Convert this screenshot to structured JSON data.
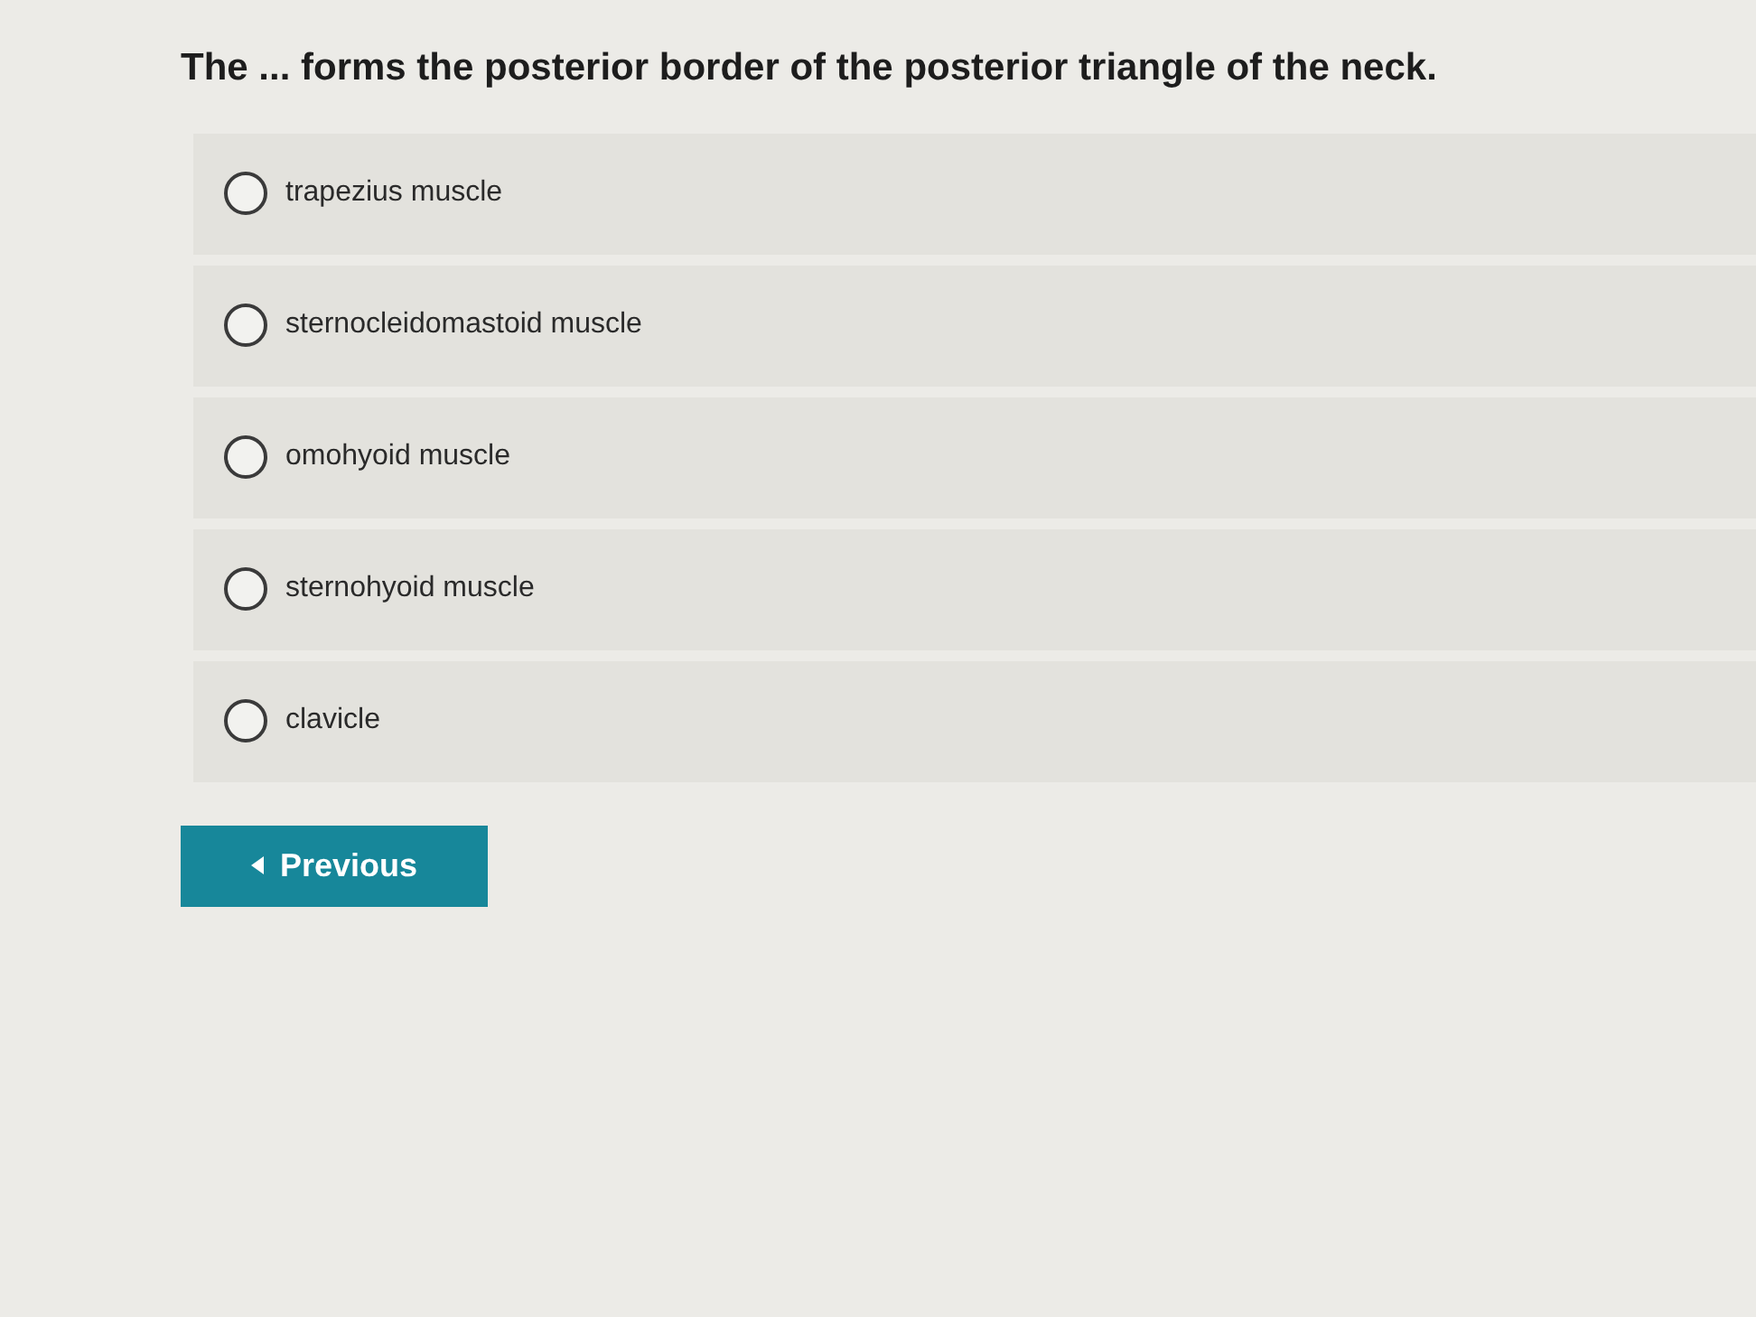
{
  "question": "The ... forms the posterior border of the posterior triangle of the neck.",
  "options": [
    {
      "label": "trapezius muscle",
      "selected": false
    },
    {
      "label": "sternocleidomastoid muscle",
      "selected": false
    },
    {
      "label": "omohyoid muscle",
      "selected": false
    },
    {
      "label": "sternohyoid muscle",
      "selected": false
    },
    {
      "label": "clavicle",
      "selected": false
    }
  ],
  "previous_button": {
    "label": "Previous"
  }
}
